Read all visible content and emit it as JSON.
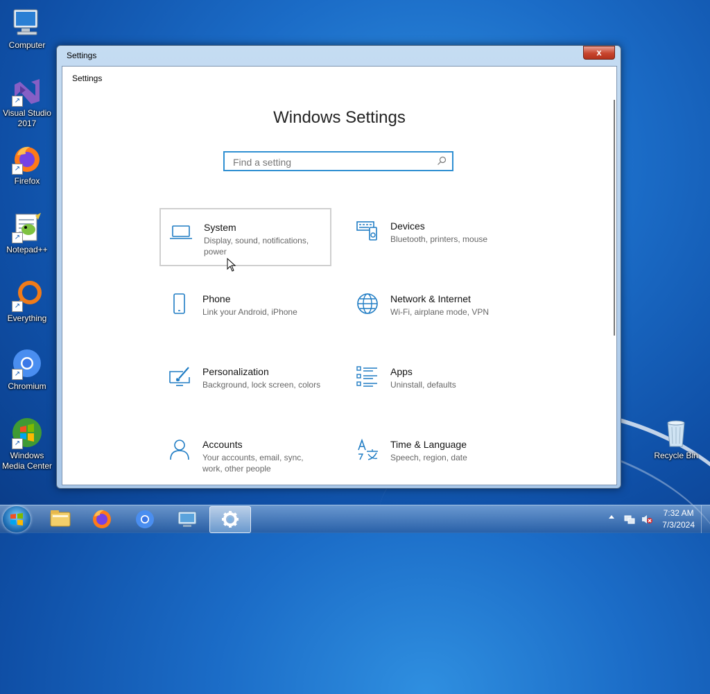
{
  "desktop": {
    "icons": [
      {
        "label": "Computer"
      },
      {
        "label": "Visual Studio 2017"
      },
      {
        "label": "Firefox"
      },
      {
        "label": "Notepad++"
      },
      {
        "label": "Everything"
      },
      {
        "label": "Chromium"
      },
      {
        "label": "Windows Media Center"
      },
      {
        "label": "Recycle Bin"
      }
    ]
  },
  "window": {
    "title": "Settings",
    "close_glyph": "x",
    "app_title": "Settings",
    "heading": "Windows Settings",
    "search_placeholder": "Find a setting",
    "categories": [
      {
        "title": "System",
        "desc": "Display, sound, notifications, power",
        "icon": "laptop-icon",
        "selected": true
      },
      {
        "title": "Devices",
        "desc": "Bluetooth, printers, mouse",
        "icon": "devices-icon"
      },
      {
        "title": "Phone",
        "desc": "Link your Android, iPhone",
        "icon": "phone-icon"
      },
      {
        "title": "Network & Internet",
        "desc": "Wi-Fi, airplane mode, VPN",
        "icon": "globe-icon"
      },
      {
        "title": "Personalization",
        "desc": "Background, lock screen, colors",
        "icon": "paintbrush-icon"
      },
      {
        "title": "Apps",
        "desc": "Uninstall, defaults",
        "icon": "apps-list-icon"
      },
      {
        "title": "Accounts",
        "desc": "Your accounts, email, sync, work, other people",
        "icon": "person-icon"
      },
      {
        "title": "Time & Language",
        "desc": "Speech, region, date",
        "icon": "time-language-icon"
      }
    ]
  },
  "taskbar": {
    "apps": [
      "file-explorer-icon",
      "firefox-icon",
      "chromium-icon",
      "remote-desktop-icon",
      "settings-gear-icon"
    ],
    "clock": {
      "time": "7:32 AM",
      "date": "7/3/2024"
    }
  },
  "colors": {
    "accent": "#1f7cc4",
    "selection_border": "#cfcfcf"
  }
}
